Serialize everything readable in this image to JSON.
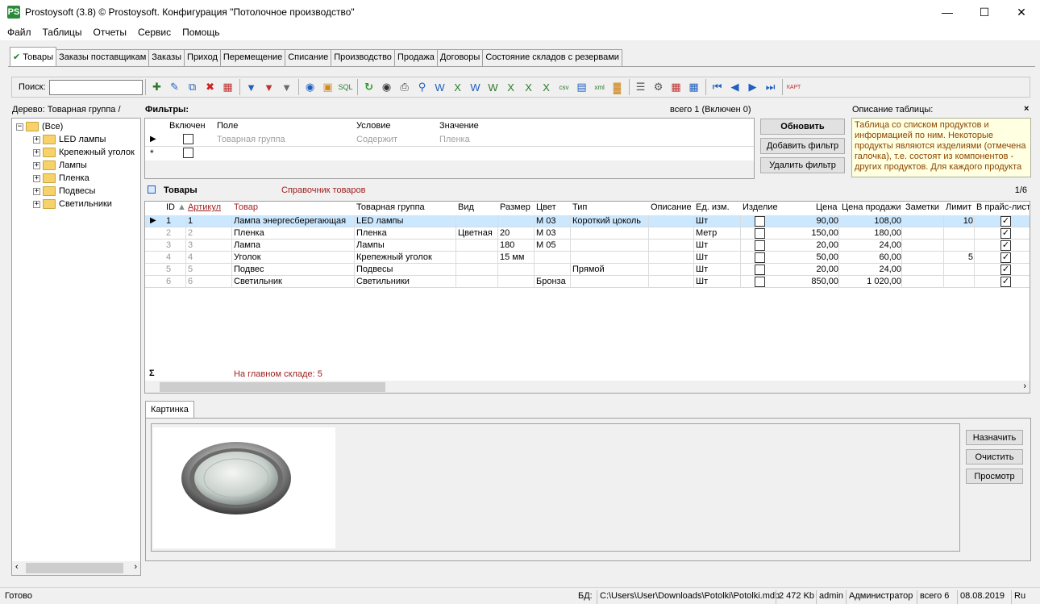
{
  "window": {
    "title": "Prostoysoft (3.8) © Prostoysoft. Конфигурация \"Потолочное производство\"",
    "icon_text": "PS"
  },
  "menu": [
    "Файл",
    "Таблицы",
    "Отчеты",
    "Сервис",
    "Помощь"
  ],
  "tabs": [
    "Товары",
    "Заказы поставщикам",
    "Заказы",
    "Приход",
    "Перемещение",
    "Списание",
    "Производство",
    "Продажа",
    "Договоры",
    "Состояние складов с резервами"
  ],
  "toolbar": {
    "search_label": "Поиск:",
    "search_value": ""
  },
  "tree": {
    "title": "Дерево: Товарная группа /",
    "root": "(Все)",
    "items": [
      "LED лампы",
      "Крепежный уголок",
      "Лампы",
      "Пленка",
      "Подвесы",
      "Светильники"
    ]
  },
  "filters": {
    "label": "Фильтры:",
    "count": "всего 1 (Включен 0)",
    "columns": [
      "Включен",
      "Поле",
      "Условие",
      "Значение"
    ],
    "row": {
      "field": "Товарная группа",
      "condition": "Содержит",
      "value": "Пленка"
    },
    "buttons": {
      "refresh": "Обновить",
      "add": "Добавить фильтр",
      "remove": "Удалить фильтр"
    }
  },
  "description": {
    "label": "Описание таблицы:",
    "close": "×",
    "text": "Таблица со списком продуктов и информацией по ним. Некоторые продукты являются изделиями (отмечена галочка), т.е. состоят из компонентов - других продуктов. Для  каждого продукта"
  },
  "goods": {
    "title": "Товары",
    "subtitle": "Справочник товаров",
    "pager": "1/6",
    "columns": [
      "ID",
      "Артикул",
      "Товар",
      "Товарная группа",
      "Вид",
      "Размер",
      "Цвет",
      "Тип",
      "Описание",
      "Ед. изм.",
      "Изделие",
      "Цена",
      "Цена продажи",
      "Заметки",
      "Лимит",
      "В прайс-лист"
    ],
    "rows": [
      {
        "id": "1",
        "article": "1",
        "name": "Лампа энергесберегающая",
        "group": "LED лампы",
        "kind": "",
        "size": "",
        "color": "М 03",
        "type": "Короткий цоколь",
        "description": "",
        "unit": "Шт",
        "product": false,
        "price": "90,00",
        "sale_price": "108,00",
        "notes": "",
        "limit": "10",
        "pricelist": true
      },
      {
        "id": "2",
        "article": "2",
        "name": "Пленка",
        "group": "Пленка",
        "kind": "Цветная",
        "size": "20",
        "color": "М 03",
        "type": "",
        "description": "",
        "unit": "Метр",
        "product": false,
        "price": "150,00",
        "sale_price": "180,00",
        "notes": "",
        "limit": "",
        "pricelist": true
      },
      {
        "id": "3",
        "article": "3",
        "name": "Лампа",
        "group": "Лампы",
        "kind": "",
        "size": "180",
        "color": "М 05",
        "type": "",
        "description": "",
        "unit": "Шт",
        "product": false,
        "price": "20,00",
        "sale_price": "24,00",
        "notes": "",
        "limit": "",
        "pricelist": true
      },
      {
        "id": "4",
        "article": "4",
        "name": "Уголок",
        "group": "Крепежный уголок",
        "kind": "",
        "size": "15 мм",
        "color": "",
        "type": "",
        "description": "",
        "unit": "Шт",
        "product": false,
        "price": "50,00",
        "sale_price": "60,00",
        "notes": "",
        "limit": "5",
        "pricelist": true
      },
      {
        "id": "5",
        "article": "5",
        "name": "Подвес",
        "group": "Подвесы",
        "kind": "",
        "size": "",
        "color": "",
        "type": "Прямой",
        "description": "",
        "unit": "Шт",
        "product": false,
        "price": "20,00",
        "sale_price": "24,00",
        "notes": "",
        "limit": "",
        "pricelist": true
      },
      {
        "id": "6",
        "article": "6",
        "name": "Светильник",
        "group": "Светильники",
        "kind": "",
        "size": "",
        "color": "Бронза",
        "type": "",
        "description": "",
        "unit": "Шт",
        "product": false,
        "price": "850,00",
        "sale_price": "1 020,00",
        "notes": "",
        "limit": "",
        "pricelist": true
      }
    ],
    "sum_label": "На главном складе: 5",
    "sum_symbol": "Σ"
  },
  "picture": {
    "tab": "Картинка",
    "buttons": {
      "assign": "Назначить",
      "clear": "Очистить",
      "view": "Просмотр"
    }
  },
  "status": {
    "ready": "Готово",
    "db_label": "БД:",
    "db_path": "C:\\Users\\User\\Downloads\\Potolki\\Potolki.mdb",
    "size": "2 472 Kb",
    "user": "admin",
    "role": "Администратор",
    "total": "всего 6",
    "date": "08.08.2019",
    "lang": "Ru"
  },
  "colors": {
    "accent_red": "#a02020",
    "selection": "#cce8ff",
    "description_text": "#8b4500"
  }
}
